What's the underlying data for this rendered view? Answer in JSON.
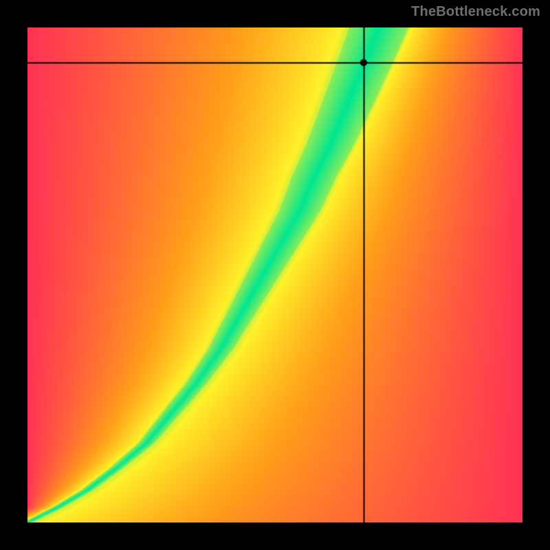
{
  "watermark": {
    "text": "TheBottleneck.com"
  },
  "chart_data": {
    "type": "heatmap",
    "title": "",
    "xlabel": "",
    "ylabel": "",
    "xlim": [
      0,
      1
    ],
    "ylim": [
      0,
      1
    ],
    "grid": false,
    "legend": false,
    "crosshair": {
      "x": 0.679,
      "y": 0.929
    },
    "marker": {
      "x": 0.679,
      "y": 0.929,
      "radius": 5
    },
    "ridge": {
      "description": "Green optimal band center (normalized axes)",
      "points": [
        {
          "x": 0.0,
          "y": 0.0
        },
        {
          "x": 0.06,
          "y": 0.03
        },
        {
          "x": 0.12,
          "y": 0.065
        },
        {
          "x": 0.18,
          "y": 0.11
        },
        {
          "x": 0.24,
          "y": 0.16
        },
        {
          "x": 0.29,
          "y": 0.22
        },
        {
          "x": 0.34,
          "y": 0.28
        },
        {
          "x": 0.39,
          "y": 0.35
        },
        {
          "x": 0.43,
          "y": 0.42
        },
        {
          "x": 0.47,
          "y": 0.49
        },
        {
          "x": 0.51,
          "y": 0.56
        },
        {
          "x": 0.55,
          "y": 0.63
        },
        {
          "x": 0.58,
          "y": 0.7
        },
        {
          "x": 0.61,
          "y": 0.76
        },
        {
          "x": 0.64,
          "y": 0.83
        },
        {
          "x": 0.665,
          "y": 0.89
        },
        {
          "x": 0.69,
          "y": 0.95
        },
        {
          "x": 0.71,
          "y": 1.0
        }
      ],
      "width_profile": [
        {
          "y": 0.0,
          "half_width": 0.01
        },
        {
          "y": 0.1,
          "half_width": 0.013
        },
        {
          "y": 0.2,
          "half_width": 0.018
        },
        {
          "y": 0.3,
          "half_width": 0.022
        },
        {
          "y": 0.4,
          "half_width": 0.028
        },
        {
          "y": 0.5,
          "half_width": 0.034
        },
        {
          "y": 0.6,
          "half_width": 0.04
        },
        {
          "y": 0.7,
          "half_width": 0.045
        },
        {
          "y": 0.8,
          "half_width": 0.05
        },
        {
          "y": 0.9,
          "half_width": 0.055
        },
        {
          "y": 1.0,
          "half_width": 0.06
        }
      ]
    },
    "colors": {
      "green": "#00e693",
      "yellow": "#fff22a",
      "orange": "#ff9f1a",
      "red": "#ff3355"
    }
  }
}
